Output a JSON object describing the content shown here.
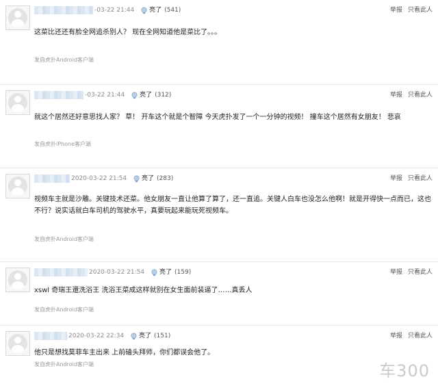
{
  "comments": [
    {
      "timestamp": "-03-22 21:44",
      "like_label": "亮了",
      "like_count": "(541)",
      "report": "举报",
      "hide": "只看此人",
      "text": "这菜比还还有脸全网追杀别人？ 现在全网知道他是菜比了。。。",
      "source": "发自虎扑Android客户端"
    },
    {
      "timestamp": "-03-22 21:44",
      "like_label": "亮了",
      "like_count": "(312)",
      "report": "举报",
      "hide": "只看此人",
      "text": "就这个居然还好意思找人家？ 草！ 开车这个就是个智障 今天虎扑发了一个一分钟的视频！ 撞车这个居然有女朋友！ 悲哀",
      "source": "发自虎扑iPhone客户端"
    },
    {
      "timestamp": "2020-03-22 21:54",
      "like_label": "亮了",
      "like_count": "(283)",
      "report": "举报",
      "hide": "只看此人",
      "text": "视频车主就是沙雕。关键技术还菜。他女朋友一直让他算了算了，还一直追。关键人白车也没怎么他啊！就是开得快一点而已，这也不行？说实话就白车司机的驾驶水平，真要玩起来能玩死视频车。",
      "source": "发自虎扑Android客户端"
    },
    {
      "timestamp": "2020-03-22 21:54",
      "like_label": "亮了",
      "like_count": "(159)",
      "report": "举报",
      "hide": "只看此人",
      "text": "xswl 奇瑞王還洗浴王 洗浴王菜成这样就别在女生面前装逼了……真丢人",
      "source": "发自虎扑Android客户端"
    },
    {
      "timestamp": "2020-03-22 22:34",
      "like_label": "亮了",
      "like_count": "(151)",
      "report": "举报",
      "hide": "只看此人",
      "text": "他只是想找莫菲车主出来 上前磕头拜师，你们都误会他了。",
      "source": "发自虎扑Android客户端"
    }
  ],
  "watermark": "车300"
}
